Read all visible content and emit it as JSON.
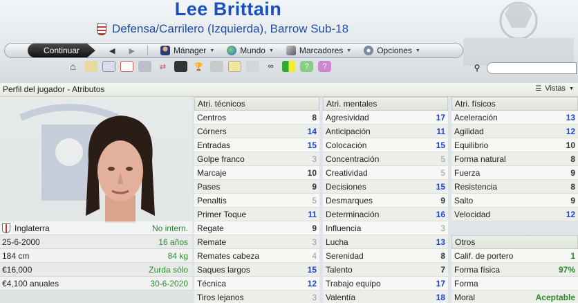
{
  "header": {
    "player_name": "Lee Brittain",
    "position_club": "Defensa/Carrilero (Izquierda), Barrow Sub-18"
  },
  "nav": {
    "continue_label": "Continuar",
    "manager_label": "Mánager",
    "world_label": "Mundo",
    "bookmarks_label": "Marcadores",
    "options_label": "Opciones"
  },
  "search": {
    "placeholder": ""
  },
  "page": {
    "title": "Perfil del jugador - Atributos",
    "views_label": "Vistas"
  },
  "info": [
    {
      "label": "Inglaterra",
      "value": "No intern."
    },
    {
      "label": "25-6-2000",
      "value": "16 años"
    },
    {
      "label": "184 cm",
      "value": "84 kg"
    },
    {
      "label": "€16,000",
      "value": "Zurda sólo"
    },
    {
      "label": "€4,100 anuales",
      "value": "30-6-2020"
    }
  ],
  "technical": {
    "header": "Atri. técnicos",
    "rows": [
      {
        "name": "Centros",
        "value": "8"
      },
      {
        "name": "Córners",
        "value": "14"
      },
      {
        "name": "Entradas",
        "value": "15"
      },
      {
        "name": "Golpe franco",
        "value": "3"
      },
      {
        "name": "Marcaje",
        "value": "10"
      },
      {
        "name": "Pases",
        "value": "9"
      },
      {
        "name": "Penaltis",
        "value": "5"
      },
      {
        "name": "Primer Toque",
        "value": "11"
      },
      {
        "name": "Regate",
        "value": "9"
      },
      {
        "name": "Remate",
        "value": "3"
      },
      {
        "name": "Remates cabeza",
        "value": "4"
      },
      {
        "name": "Saques largos",
        "value": "15"
      },
      {
        "name": "Técnica",
        "value": "12"
      },
      {
        "name": "Tiros lejanos",
        "value": "3"
      }
    ]
  },
  "mental": {
    "header": "Atri. mentales",
    "rows": [
      {
        "name": "Agresividad",
        "value": "17"
      },
      {
        "name": "Anticipación",
        "value": "11"
      },
      {
        "name": "Colocación",
        "value": "15"
      },
      {
        "name": "Concentración",
        "value": "5"
      },
      {
        "name": "Creatividad",
        "value": "5"
      },
      {
        "name": "Decisiones",
        "value": "15"
      },
      {
        "name": "Desmarques",
        "value": "9"
      },
      {
        "name": "Determinación",
        "value": "16"
      },
      {
        "name": "Influencia",
        "value": "3"
      },
      {
        "name": "Lucha",
        "value": "13"
      },
      {
        "name": "Serenidad",
        "value": "8"
      },
      {
        "name": "Talento",
        "value": "7"
      },
      {
        "name": "Trabajo equipo",
        "value": "17"
      },
      {
        "name": "Valentía",
        "value": "18"
      }
    ]
  },
  "physical": {
    "header": "Atri. físicos",
    "rows": [
      {
        "name": "Aceleración",
        "value": "13"
      },
      {
        "name": "Agilidad",
        "value": "12"
      },
      {
        "name": "Equilibrio",
        "value": "10"
      },
      {
        "name": "Forma natural",
        "value": "8"
      },
      {
        "name": "Fuerza",
        "value": "9"
      },
      {
        "name": "Resistencia",
        "value": "8"
      },
      {
        "name": "Salto",
        "value": "9"
      },
      {
        "name": "Velocidad",
        "value": "12"
      }
    ]
  },
  "others": {
    "header": "Otros",
    "rows": [
      {
        "name": "Calif. de portero",
        "value": "1"
      },
      {
        "name": "Forma física",
        "value": "97%"
      },
      {
        "name": "Forma",
        "value": ""
      },
      {
        "name": "Moral",
        "value": "Aceptable"
      }
    ]
  },
  "colors": {
    "accent": "#1a4fc0",
    "high_value": "#1f44c8",
    "positive": "#2d8a2d",
    "low_value": "#9a9a9a"
  }
}
